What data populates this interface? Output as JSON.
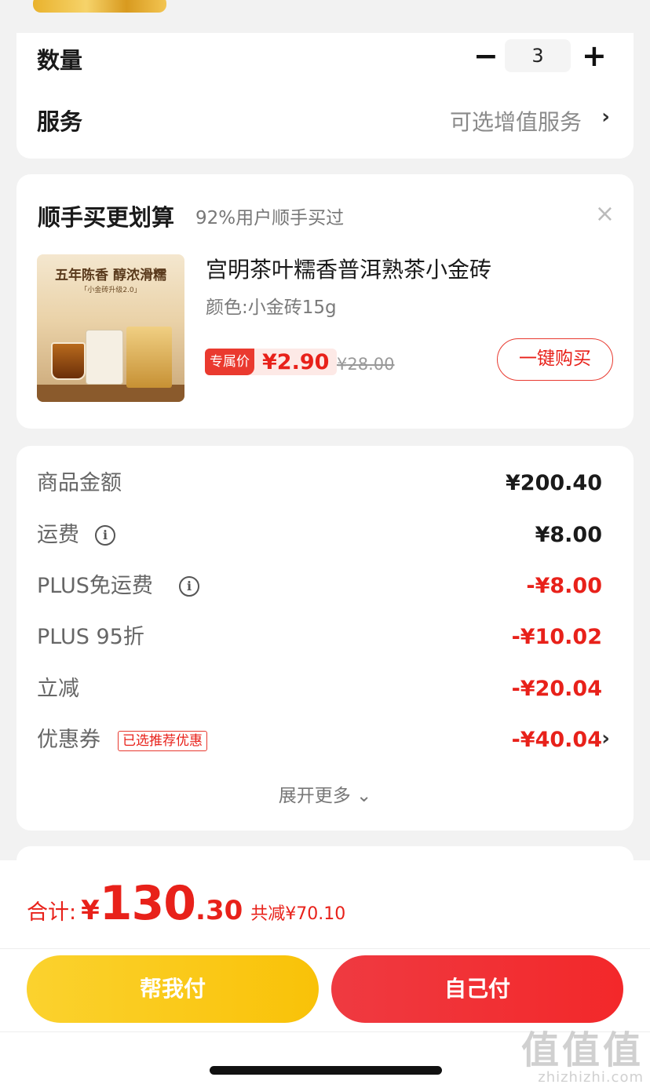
{
  "quantity_section": {
    "label": "数量",
    "minus": "−",
    "value": "3",
    "plus": "+"
  },
  "service_section": {
    "label": "服务",
    "value": "可选增值服务",
    "chevron": "›"
  },
  "addon": {
    "title": "顺手买更划算",
    "subtitle": "92%用户顺手买过",
    "close": "×",
    "image_text": {
      "slogan": "五年陈香  醇浓滑糯",
      "ribbon": "「小金砖升级2.0」"
    },
    "product_name": "宫明茶叶糯香普洱熟茶小金砖",
    "product_spec": "颜色:小金砖15g",
    "price_tag": "专属价",
    "price_now": "¥2.90",
    "price_old": "¥28.00",
    "buy_button": "一键购买"
  },
  "summary": {
    "rows": [
      {
        "label": "商品金额",
        "value": "¥200.40"
      },
      {
        "label": "运费",
        "value": "¥8.00",
        "info": "i"
      },
      {
        "label": "PLUS免运费",
        "value": "-¥8.00",
        "info": "i"
      },
      {
        "label": "PLUS 95折",
        "value": "-¥10.02"
      },
      {
        "label": "立减",
        "value": "-¥20.04"
      },
      {
        "label": "优惠券",
        "badge": "已选推荐优惠",
        "value": "-¥40.04",
        "chevron": "›"
      }
    ],
    "expand": "展开更多 ⌄"
  },
  "checkout": {
    "total_label": "合计:",
    "currency": "¥",
    "total_int": "130",
    "total_dec": ".30",
    "saved": "共减¥70.10",
    "help_pay": "帮我付",
    "self_pay": "自己付"
  },
  "watermark": {
    "big": "值值值",
    "small": "zhizhizhi.com"
  },
  "colors": {
    "accent_red": "#e8211a",
    "help_pay_yellow": "#f9c208",
    "self_pay_red": "#f3282a"
  }
}
